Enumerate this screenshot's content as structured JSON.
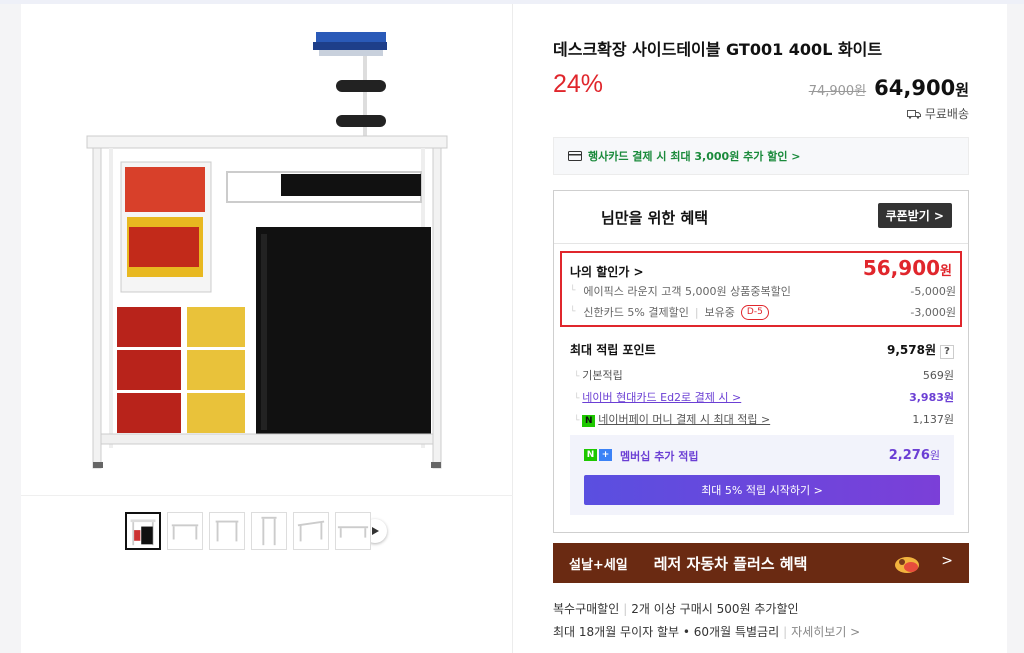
{
  "product": {
    "title": "데스크확장 사이드테이블 GT001 400L 화이트",
    "discount_rate": "24%",
    "original_price": "74,900원",
    "sale_price": "64,900",
    "sale_price_unit": "원",
    "shipping": "무료배송"
  },
  "card_banner": {
    "text": "행사카드 결제 시 최대 3,000원 추가 할인 >"
  },
  "benefits": {
    "title": "님만을 위한 혜택",
    "coupon_button": "쿠폰받기 >",
    "my_price_label": "나의 할인가 >",
    "my_price_value": "56,900",
    "my_price_unit": "원",
    "discounts": [
      {
        "label": "에이픽스 라운지 고객 5,000원 상품중복할인",
        "value": "-5,000원"
      },
      {
        "label": "신한카드 5% 결제할인",
        "holding": "보유중",
        "dday": "D-5",
        "value": "-3,000원"
      }
    ],
    "points_label": "최대 적립 포인트",
    "points_value": "9,578원",
    "points_help": "?",
    "point_rows": [
      {
        "label": "기본적립",
        "value": "569원"
      },
      {
        "label": "네이버 현대카드 Ed2로 결제 시 >",
        "value": "3,983원"
      },
      {
        "label": "네이버페이 머니 결제 시 최대 적립 >",
        "value": "1,137원"
      }
    ],
    "membership_label": "멤버십 추가 적립",
    "membership_value": "2,276",
    "membership_unit": "원",
    "membership_button": "최대 5% 적립 시작하기 >"
  },
  "promo": {
    "tag": "설날+세일",
    "text": "레저 자동차 플러스 혜택",
    "arrow": ">"
  },
  "info": {
    "line1_a": "복수구매할인",
    "line1_b": "2개 이상 구매시 500원 추가할인",
    "line2_a": "최대 18개월 무이자 할부 • 60개월 특별금리",
    "line2_b": "자세히보기 >"
  },
  "icons": [
    "truck-icon",
    "card-icon",
    "play-icon",
    "question-icon",
    "npay-icon",
    "naver-plus-icon",
    "promo-gift-icon"
  ],
  "colors": {
    "accent_red": "#e0262c",
    "purple": "#6b3fd4",
    "promo_bg": "#6a2a12",
    "card_green": "#1a8a3b"
  }
}
